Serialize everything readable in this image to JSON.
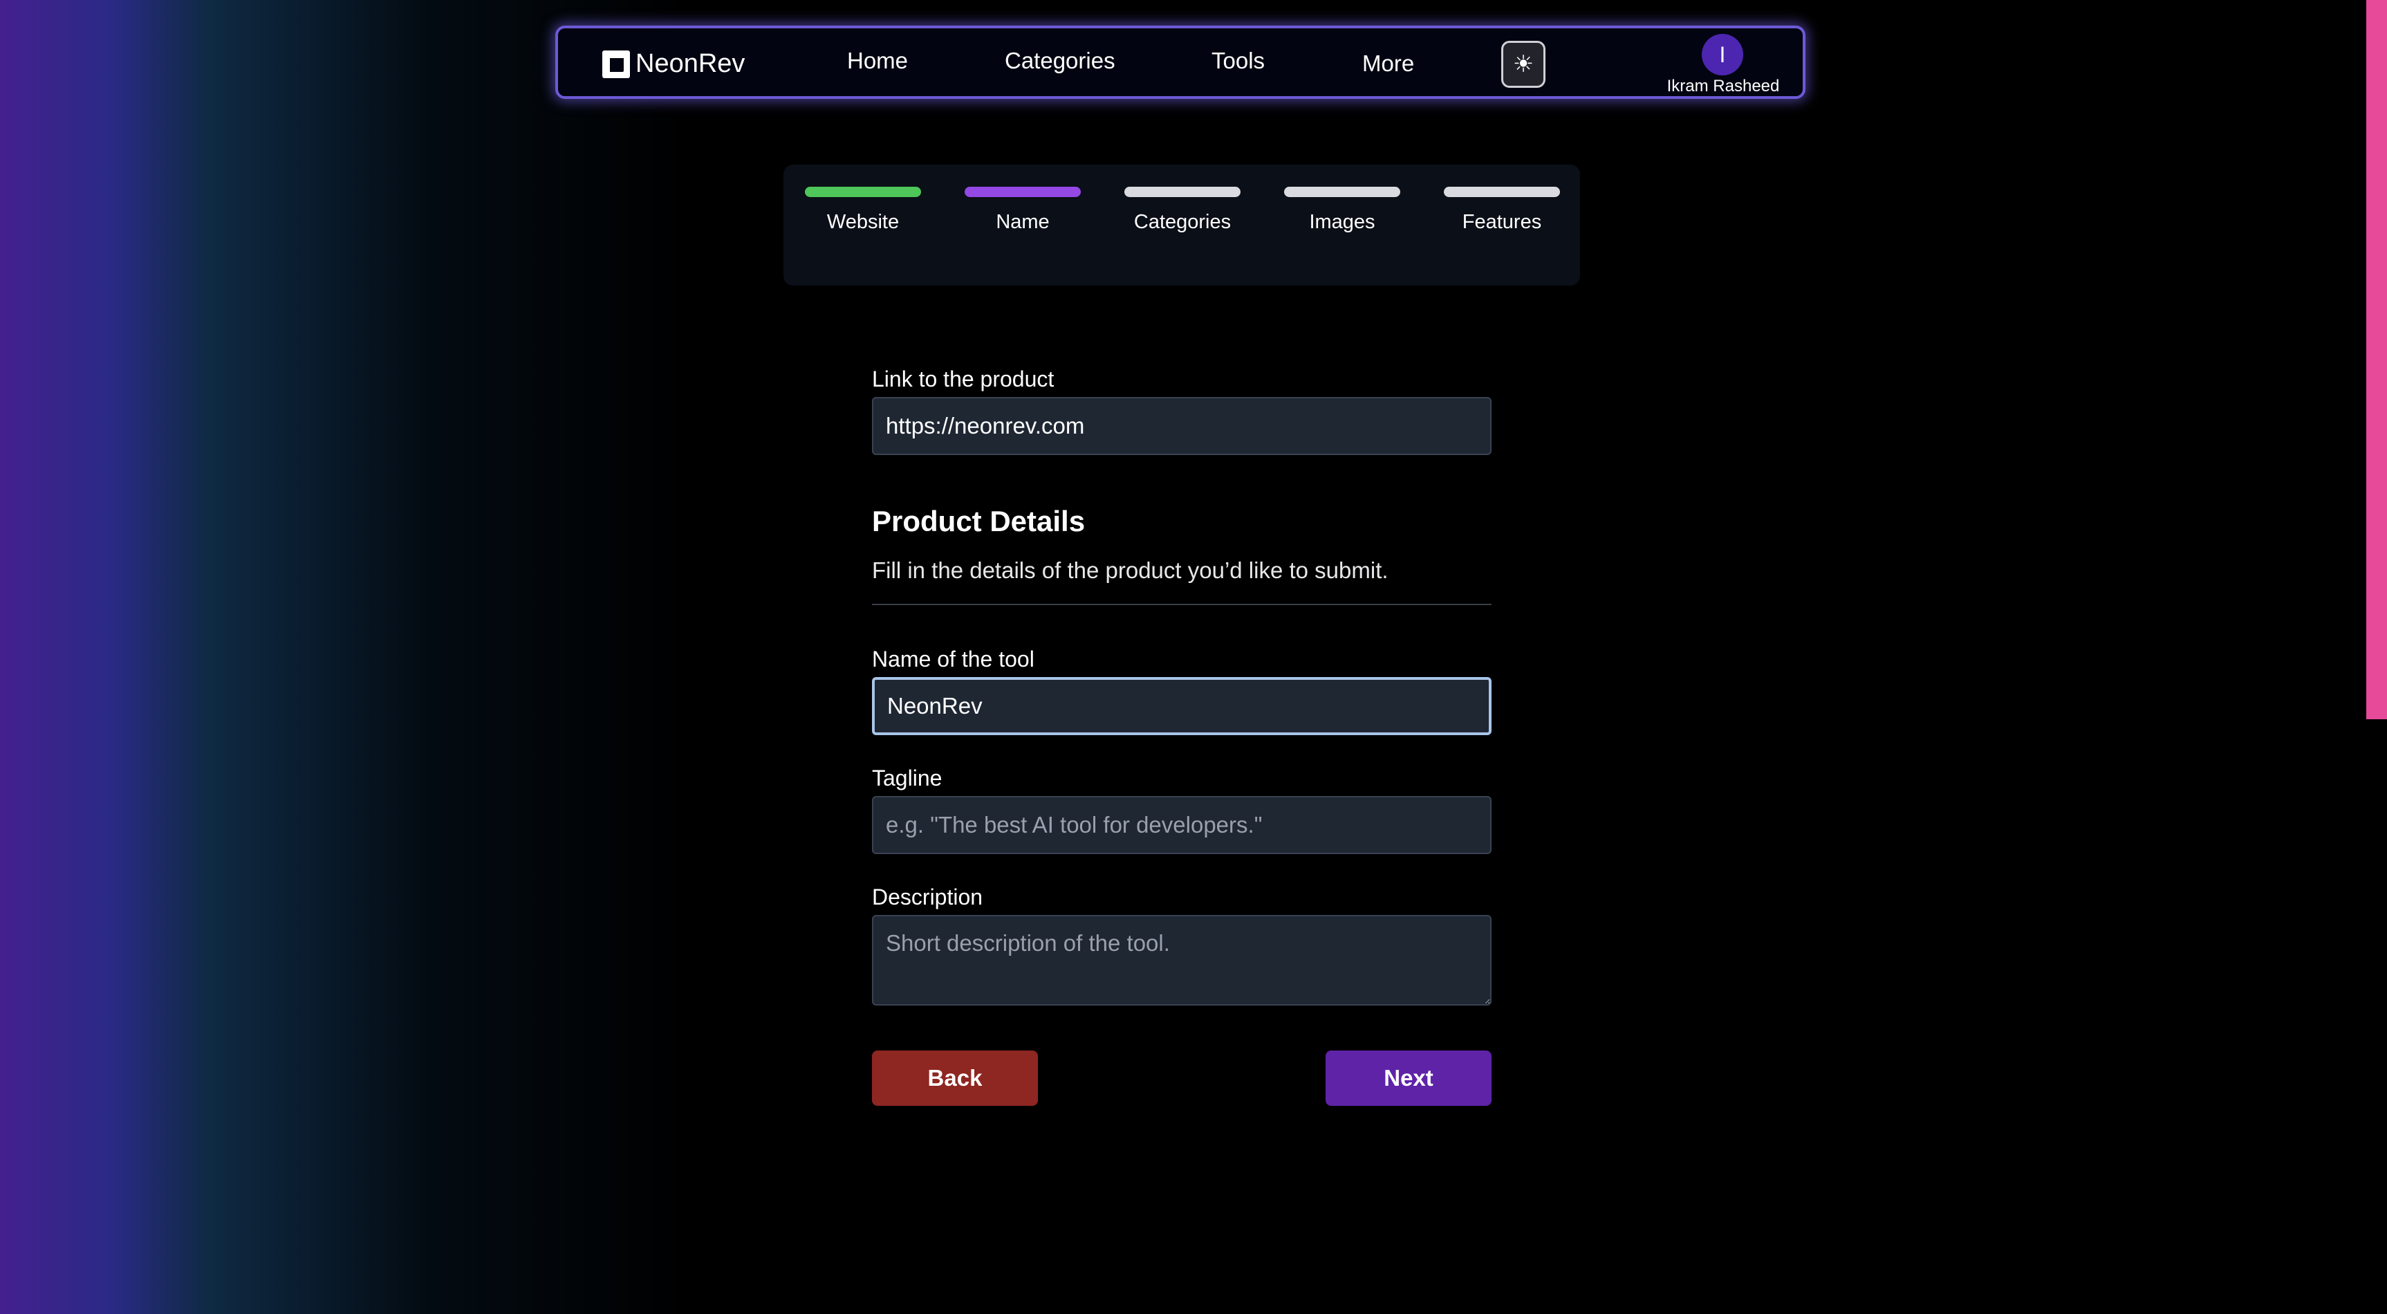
{
  "navbar": {
    "brand": "NeonRev",
    "links": [
      "Home",
      "Categories",
      "Tools",
      "More"
    ],
    "theme_icon": "sun-icon",
    "user_initial": "I",
    "user_name": "Ikram Rasheed"
  },
  "stepper": {
    "steps": [
      {
        "label": "Website",
        "color": "#4ec65a"
      },
      {
        "label": "Name",
        "color": "#9448e4"
      },
      {
        "label": "Categories",
        "color": "#d9dbe0"
      },
      {
        "label": "Images",
        "color": "#d9dbe0"
      },
      {
        "label": "Features",
        "color": "#d9dbe0"
      }
    ]
  },
  "form": {
    "link_label": "Link to the product",
    "link_value": "https://neonrev.com",
    "section_title": "Product Details",
    "section_desc": "Fill in the details of the product you’d like to submit.",
    "name_label": "Name of the tool",
    "name_value": "NeonRev",
    "tagline_label": "Tagline",
    "tagline_placeholder": "e.g. \"The best AI tool for developers.\"",
    "description_label": "Description",
    "description_placeholder": "Short description of the tool."
  },
  "actions": {
    "back_label": "Back",
    "next_label": "Next"
  },
  "colors": {
    "accent": "#5f23a8",
    "back": "#8e2621",
    "scrollbar": "#e64a98"
  }
}
